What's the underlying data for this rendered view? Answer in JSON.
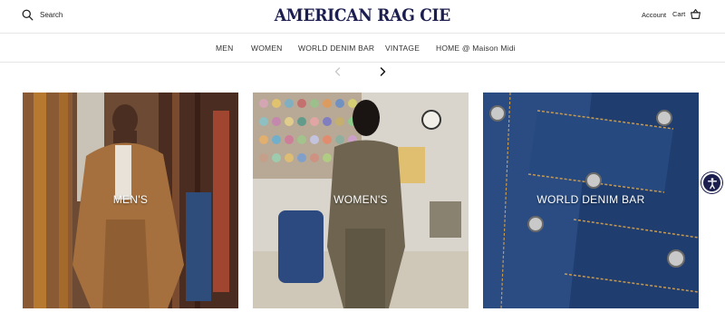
{
  "header": {
    "search_label": "Search",
    "logo_text": "AMERICAN RAG CIE",
    "account_label": "Account",
    "cart_label": "Cart"
  },
  "nav": {
    "items": [
      {
        "label": "MEN"
      },
      {
        "label": "WOMEN"
      },
      {
        "label": "WORLD DENIM BAR"
      },
      {
        "label": "VINTAGE"
      },
      {
        "label": "HOME @ Maison Midi"
      }
    ]
  },
  "carousel": {
    "prev_icon": "chevron-left-icon",
    "next_icon": "chevron-right-icon"
  },
  "cards": [
    {
      "label": "MEN'S"
    },
    {
      "label": "WOMEN'S"
    },
    {
      "label": "WORLD DENIM BAR"
    }
  ],
  "colors": {
    "brand": "#1c1e4f",
    "text": "#1a1a1a",
    "divider": "#e6e6e6"
  },
  "accessibility": {
    "icon": "accessibility-icon"
  }
}
